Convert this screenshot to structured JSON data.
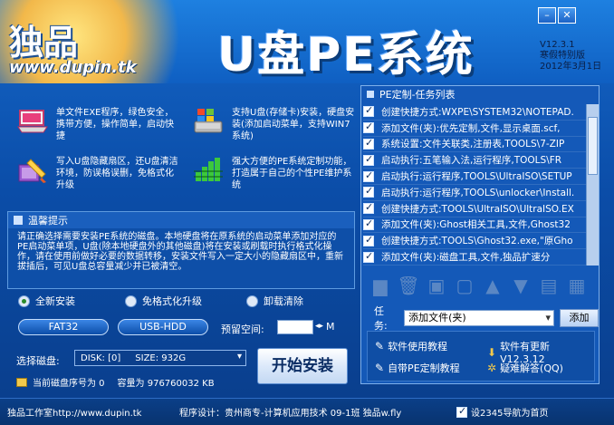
{
  "header": {
    "logo_text": "独品",
    "logo_url": "www.dupin.tk",
    "title": "U盘PE系统",
    "version": "V12.3.1",
    "edition": "寒假特别版",
    "date": "2012年3月1日"
  },
  "features": [
    {
      "icon": "laptop-icon",
      "text": "单文件EXE程序，绿色安全，携带方便，操作简单，启动快捷"
    },
    {
      "icon": "usb-harddisk-icon",
      "text": "支持U盘(存储卡)安装，硬盘安装(添加启动菜单，支持WIN7系统)"
    },
    {
      "icon": "hidden-partition-icon",
      "text": "写入U盘隐藏扇区，还U盘清洁环境，防误格误删，免格式化升级"
    },
    {
      "icon": "customize-icon",
      "text": "强大方便的PE系统定制功能，打造属于自己的个性PE维护系统"
    }
  ],
  "tip": {
    "title": "温馨提示",
    "text": "请正确选择需要安装PE系统的磁盘。本地硬盘将在原系统的启动菜单添加对应的PE启动菜单项，U盘(除本地硬盘外的其他磁盘)将在安装或刷载时执行格式化操作，请在使用前做好必要的数据转移，安装文件写入一定大小的隐藏扇区中，重新拔插后，可见U盘总容量减少并已被清空。"
  },
  "task_panel": {
    "title": "PE定制-任务列表",
    "tasks": [
      "创建快捷方式:WXPE\\SYSTEM32\\NOTEPAD.",
      "添加文件(夹):优先定制,文件,显示桌面.scf,",
      "系统设置:文件关联类,注册表,TOOLS\\7-ZIP",
      "启动执行:五笔输入法,运行程序,TOOLS\\FR",
      "启动执行:运行程序,TOOLS\\UltraISO\\SETUP",
      "启动执行:运行程序,TOOLS\\unlocker\\Install.",
      "创建快捷方式:TOOLS\\UltraISO\\UltraISO.EX",
      "添加文件(夹):Ghost相关工具,文件,Ghost32",
      "创建快捷方式:TOOLS\\Ghost32.exe,\"原Gho",
      "添加文件(夹):磁盘工具,文件,独品扩速分"
    ],
    "toolbar_icons": [
      "floppy-icon",
      "trash-icon",
      "lock-icon",
      "unlock-icon",
      "up-arrow-icon",
      "down-arrow-icon",
      "load-icon",
      "save-icon"
    ],
    "task_label": "任务:",
    "task_value": "添加文件(夹)",
    "add_label": "添加"
  },
  "links": [
    {
      "icon": "wrench-icon",
      "label": "软件使用教程"
    },
    {
      "icon": "download-icon",
      "label": "软件有更新 V12.3.12"
    },
    {
      "icon": "wrench-icon",
      "label": "自带PE定制教程"
    },
    {
      "icon": "help-icon",
      "label": "疑难解答(QQ)"
    }
  ],
  "install": {
    "modes": [
      "全新安装",
      "免格式化升级",
      "卸载清除"
    ],
    "selected_mode": "全新安装",
    "fs_label": "FAT32",
    "boot_label": "USB-HDD",
    "space_label": "预留空间:",
    "space_unit": "M",
    "disk_label": "选择磁盘:",
    "disk_value": "DISK: [0]",
    "disk_size": "SIZE: 932G",
    "current_disk_label": "当前磁盘序号为 0",
    "capacity_label": "容量为 976760032 KB",
    "start_label": "开始安装"
  },
  "statusbar": {
    "studio": "独品工作室http://www.dupin.tk",
    "designer": "程序设计：贵州商专-计算机应用技术 09-1班 独品w.fly",
    "homepage": "设2345导航为首页"
  }
}
